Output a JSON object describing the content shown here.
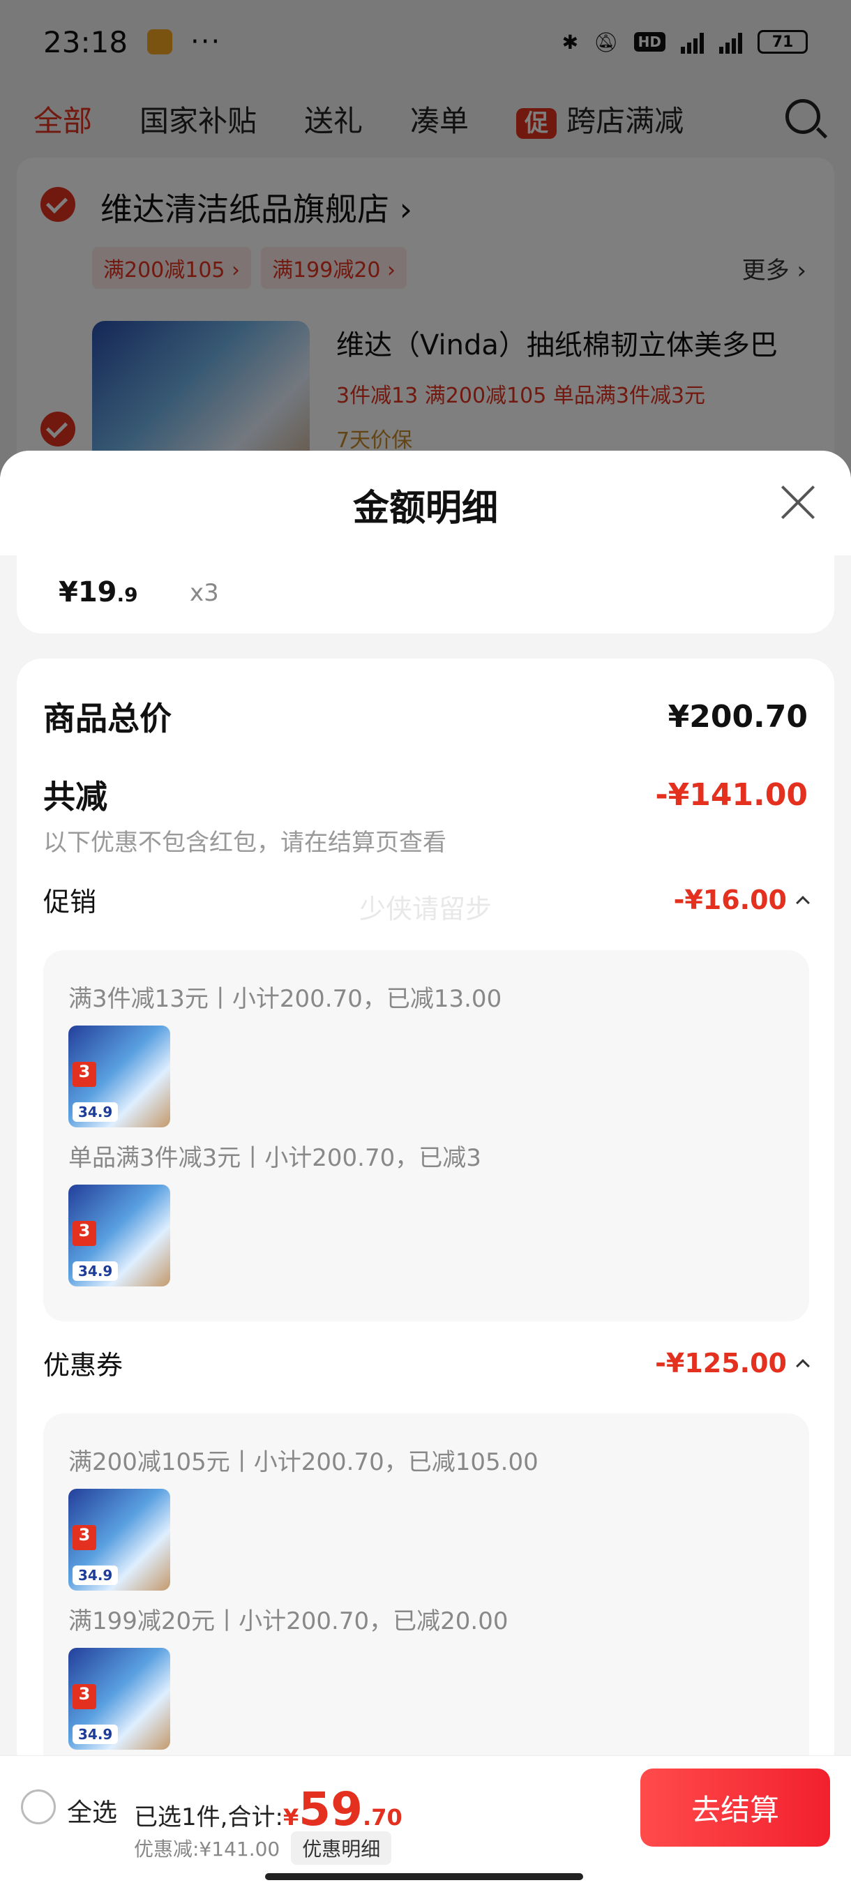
{
  "status_bar": {
    "time": "23:18",
    "more": "···",
    "battery": "71",
    "hd": "HD"
  },
  "tabs": {
    "items": [
      "全部",
      "国家补贴",
      "送礼",
      "凑单"
    ],
    "promo_badge": "促",
    "promo_label": "跨店满减"
  },
  "store": {
    "name": "维达清洁纸品旗舰店 ›",
    "tags": [
      "满200减105 ›",
      "满199减20 ›"
    ],
    "more": "更多 ›",
    "product": {
      "title": "维达（Vinda）抽纸棉韧立体美多巴",
      "promos": "3件减13  满200减105  单品满3件减3元",
      "guarantee": "7天价保"
    }
  },
  "sheet": {
    "title": "金额明细",
    "item": {
      "price_main": "¥19",
      "price_dec": ".9",
      "qty": "x3"
    },
    "total_label": "商品总价",
    "total_value": "¥200.70",
    "reduce_label": "共减",
    "reduce_value": "-¥141.00",
    "reduce_note": "以下优惠不包含红包，请在结算页查看",
    "watermark": "少侠请留步",
    "promo": {
      "label": "促销",
      "value": "-¥16.00",
      "lines": [
        "满3件减13元丨小计200.70，已减13.00",
        "单品满3件减3元丨小计200.70，已减3"
      ]
    },
    "coupon": {
      "label": "优惠券",
      "value": "-¥125.00",
      "lines": [
        "满200减105元丨小计200.70，已减105.00",
        "满199减20元丨小计200.70，已减20.00"
      ]
    },
    "thumb": {
      "price_tag": "34.9",
      "badge": "3"
    }
  },
  "bottom": {
    "select_all": "全选",
    "selected_prefix": "已选1件,合计:",
    "currency": "¥",
    "amount": "59",
    "amount_dec": ".70",
    "discount": "优惠减:¥141.00",
    "detail_chip": "优惠明细",
    "checkout": "去结算"
  },
  "colors": {
    "accent": "#e3301f",
    "checkout": "#f2202e"
  }
}
